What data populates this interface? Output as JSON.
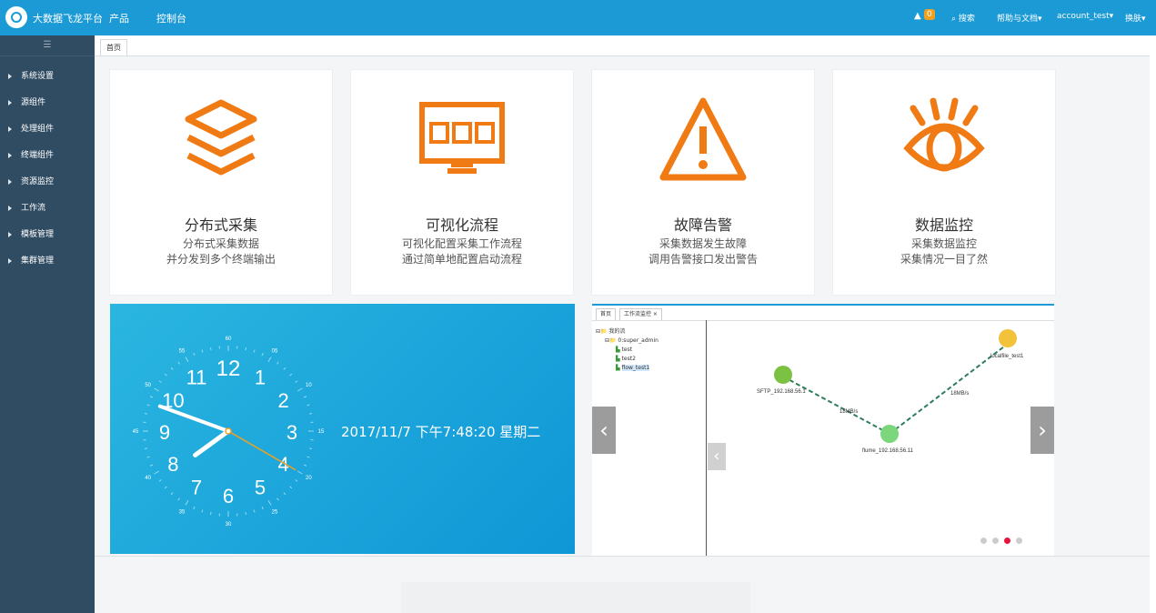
{
  "topbar": {
    "brand": "大数据飞龙平台",
    "nav": [
      "产品",
      "控制台"
    ],
    "notification_count": "0",
    "search_label": "搜索",
    "help_label": "帮助与文档",
    "account_label": "account_test",
    "lang_label": "换肤"
  },
  "sidebar": {
    "toggle": "☰",
    "items": [
      "系统设置",
      "源组件",
      "处理组件",
      "终端组件",
      "资源监控",
      "工作流",
      "模板管理",
      "集群管理"
    ]
  },
  "tabs": [
    "首页"
  ],
  "cards": [
    {
      "icon": "layers-icon",
      "title": "分布式采集",
      "desc1": "分布式采集数据",
      "desc2": "并分发到多个终端输出"
    },
    {
      "icon": "flow-monitor-icon",
      "title": "可视化流程",
      "desc1": "可视化配置采集工作流程",
      "desc2": "通过简单地配置启动流程"
    },
    {
      "icon": "warning-icon",
      "title": "故障告警",
      "desc1": "采集数据发生故障",
      "desc2": "调用告警接口发出警告"
    },
    {
      "icon": "eye-icon",
      "title": "数据监控",
      "desc1": "采集数据监控",
      "desc2": "采集情况一目了然"
    }
  ],
  "clock": {
    "datetime": "2017/11/7 下午7:48:20 星期二",
    "numbers": [
      "12",
      "1",
      "2",
      "3",
      "4",
      "5",
      "6",
      "7",
      "8",
      "9",
      "10",
      "11"
    ],
    "minute_labels": [
      "60",
      "05",
      "10",
      "15",
      "20",
      "25",
      "30",
      "35",
      "40",
      "45",
      "50",
      "55"
    ]
  },
  "carousel": {
    "tabs": [
      "首页",
      "工作流监控 ×"
    ],
    "tree": {
      "root": "我的流",
      "user": "0:super_admin",
      "flows": [
        "test",
        "test2",
        "flow_test1"
      ]
    },
    "nodes": [
      {
        "label": "SFTP_192.168.56.1"
      },
      {
        "label": "flume_192.168.56.11"
      },
      {
        "label": "localfile_test1"
      }
    ],
    "edges": [
      "18MB/s",
      "18MB/s"
    ],
    "dots": 4,
    "active_dot": 3
  },
  "colors": {
    "accent": "#1b9ad6",
    "sidebar": "#304c63",
    "icon_orange": "#f07a14",
    "active_dot": "#e8123c"
  }
}
